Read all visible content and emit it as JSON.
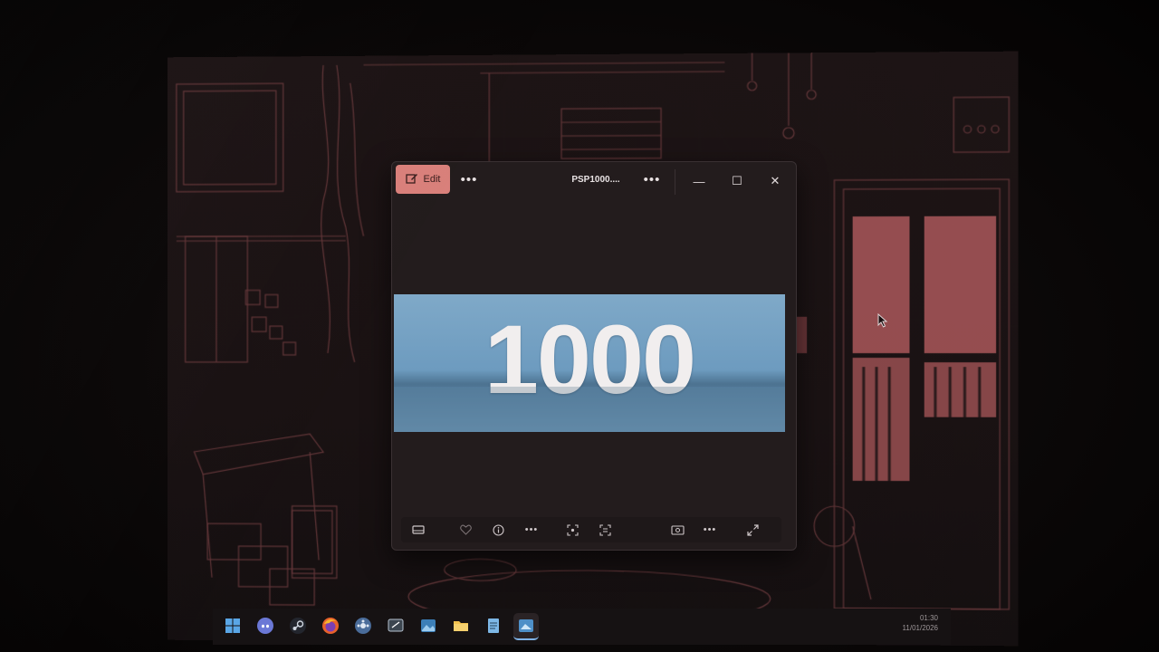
{
  "window": {
    "title": "PSP1000....",
    "edit_label": "Edit",
    "more_left": "•••",
    "more_right": "•••",
    "minimize": "—",
    "maximize": "☐",
    "close": "✕"
  },
  "image": {
    "text": "1000"
  },
  "bottom_toolbar": {
    "more_1": "•••",
    "more_2": "•••"
  },
  "taskbar": {
    "time": "01:30",
    "date": "11/01/2026",
    "apps": [
      "start-icon",
      "discord-icon",
      "steam-icon",
      "firefox-icon",
      "launcher-icon",
      "snipping-tool-icon",
      "photos-icon",
      "file-explorer-icon",
      "notepad-icon",
      "photos-viewer-icon"
    ]
  },
  "colors": {
    "edit_accent": "#d9807b",
    "wallpaper_line": "#8a4a4e",
    "window_bg": "#231c1d"
  }
}
